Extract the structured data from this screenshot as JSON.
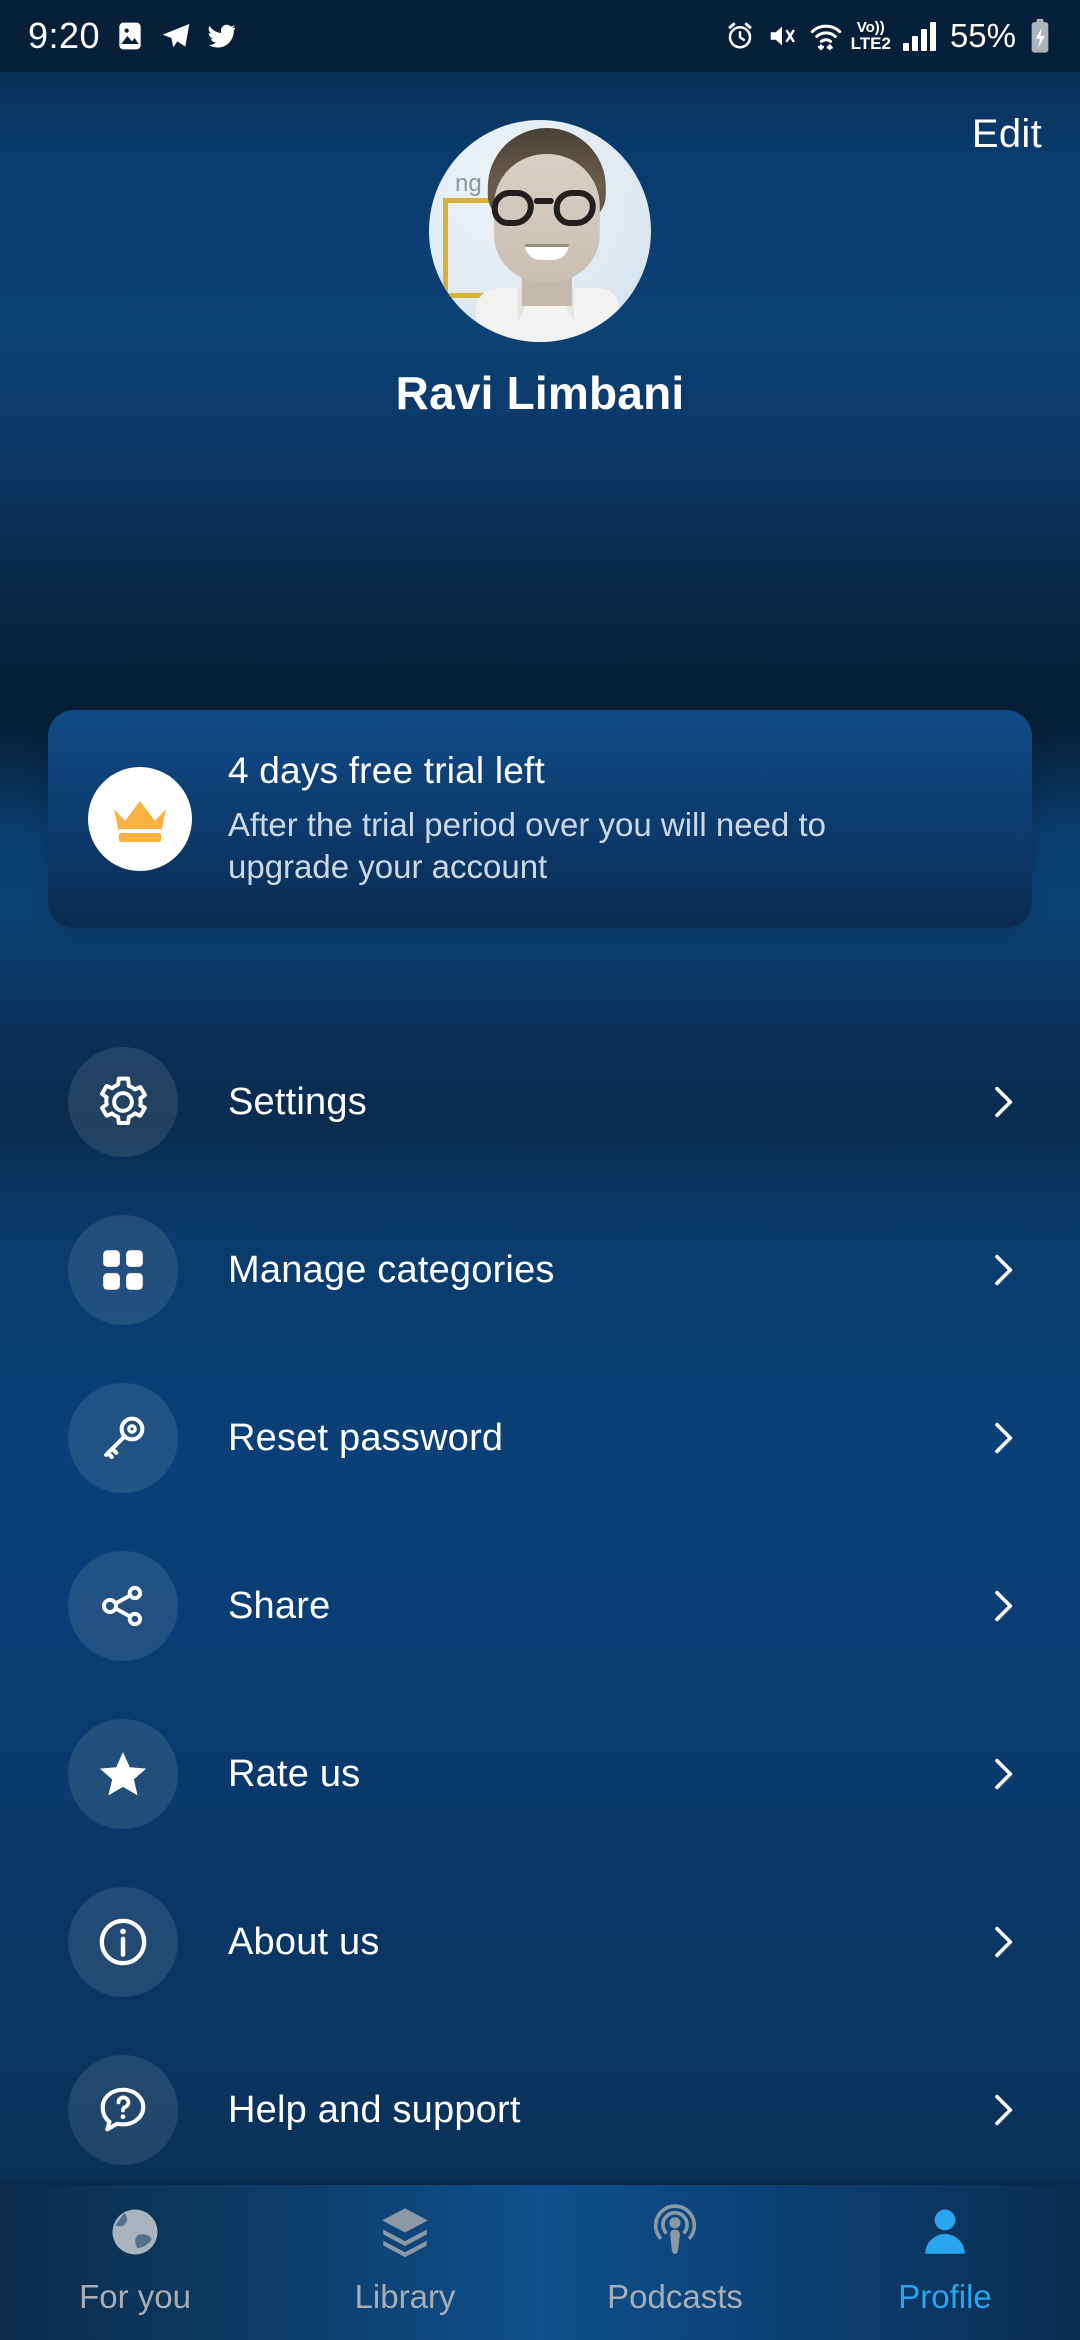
{
  "status_bar": {
    "time": "9:20",
    "left_icons": [
      "photos-icon",
      "telegram-icon",
      "twitter-icon"
    ],
    "right_icons": [
      "alarm-icon",
      "mute-icon",
      "wifi-icon",
      "signal-bars-icon",
      "battery-charging-icon"
    ],
    "network_top": "Vo))",
    "network_bottom": "LTE2",
    "battery": "55%"
  },
  "header": {
    "edit_label": "Edit"
  },
  "profile": {
    "name": "Ravi Limbani",
    "avatar_caption": "ng"
  },
  "trial": {
    "icon": "crown-icon",
    "title": "4 days free trial left",
    "subtitle": "After the trial period over you will need to upgrade your account"
  },
  "menu": {
    "items": [
      {
        "label": "Settings",
        "icon": "gear-icon"
      },
      {
        "label": "Manage categories",
        "icon": "grid-icon"
      },
      {
        "label": "Reset password",
        "icon": "key-icon"
      },
      {
        "label": "Share",
        "icon": "share-icon"
      },
      {
        "label": "Rate us",
        "icon": "star-icon"
      },
      {
        "label": "About us",
        "icon": "info-icon"
      },
      {
        "label": "Help and support",
        "icon": "question-bubble-icon"
      }
    ]
  },
  "bottom_nav": {
    "items": [
      {
        "label": "For you",
        "icon": "globe-icon",
        "active": false
      },
      {
        "label": "Library",
        "icon": "layers-icon",
        "active": false
      },
      {
        "label": "Podcasts",
        "icon": "podcast-icon",
        "active": false
      },
      {
        "label": "Profile",
        "icon": "person-icon",
        "active": true
      }
    ]
  },
  "colors": {
    "background_top": "#07233f",
    "background_mid": "#0a4078",
    "accent_active": "#28a5ef",
    "crown_gold": "#fbb042",
    "avatar_frame_gold": "#d8b13a",
    "inactive_nav": "#a7aeb5"
  }
}
